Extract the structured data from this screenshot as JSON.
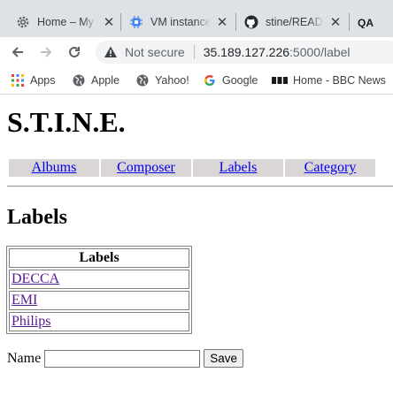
{
  "browser": {
    "tabs": [
      {
        "title": "Home – My",
        "icon": "gear-icon"
      },
      {
        "title": "VM instance",
        "icon": "chip-icon"
      },
      {
        "title": "stine/READI",
        "icon": "github-icon"
      },
      {
        "title": "QA",
        "icon": "qa-icon"
      }
    ],
    "address": {
      "security_label": "Not secure",
      "host": "35.189.127.226",
      "path": ":5000/label"
    },
    "bookmarks": [
      {
        "label": "Apps",
        "icon": "apps-grid-icon"
      },
      {
        "label": "Apple",
        "icon": "globe-icon"
      },
      {
        "label": "Yahoo!",
        "icon": "globe-icon"
      },
      {
        "label": "Google",
        "icon": "google-icon"
      },
      {
        "label": "Home - BBC News",
        "icon": "bbc-icon"
      }
    ]
  },
  "site": {
    "title": "S.T.I.N.E.",
    "nav": [
      "Albums",
      "Composer",
      "Labels",
      "Category"
    ]
  },
  "page": {
    "heading": "Labels",
    "table_header": "Labels",
    "labels": [
      "DECCA",
      "EMI",
      "Philips"
    ],
    "form": {
      "name_label": "Name",
      "name_value": "",
      "save_label": "Save"
    }
  }
}
